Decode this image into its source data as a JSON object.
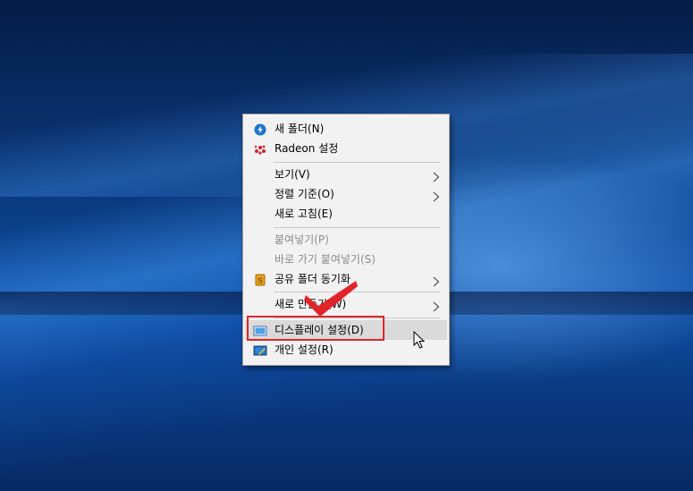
{
  "context_menu": {
    "items": [
      {
        "label": "새 폴더(N)",
        "icon": "new-folder-icon"
      },
      {
        "label": "Radeon 설정",
        "icon": "radeon-icon"
      },
      {
        "label": "보기(V)",
        "submenu": true
      },
      {
        "label": "정렬 기준(O)",
        "submenu": true
      },
      {
        "label": "새로 고침(E)"
      },
      {
        "label": "붙여넣기(P)",
        "disabled": true
      },
      {
        "label": "바로 가기 붙여넣기(S)",
        "disabled": true
      },
      {
        "label": "공유 폴더 동기화",
        "icon": "sync-folder-icon",
        "submenu": true
      },
      {
        "label": "새로 만들기(W)",
        "submenu": true
      },
      {
        "label": "디스플레이 설정(D)",
        "icon": "display-settings-icon",
        "highlighted": true
      },
      {
        "label": "개인 설정(R)",
        "icon": "personalize-icon"
      }
    ]
  },
  "colors": {
    "menu_bg": "#f2f2f2",
    "hover_bg": "#dadada",
    "highlight_box": "#e0252a",
    "checkmark": "#e0252a",
    "disabled_text": "#8a8a8a"
  }
}
